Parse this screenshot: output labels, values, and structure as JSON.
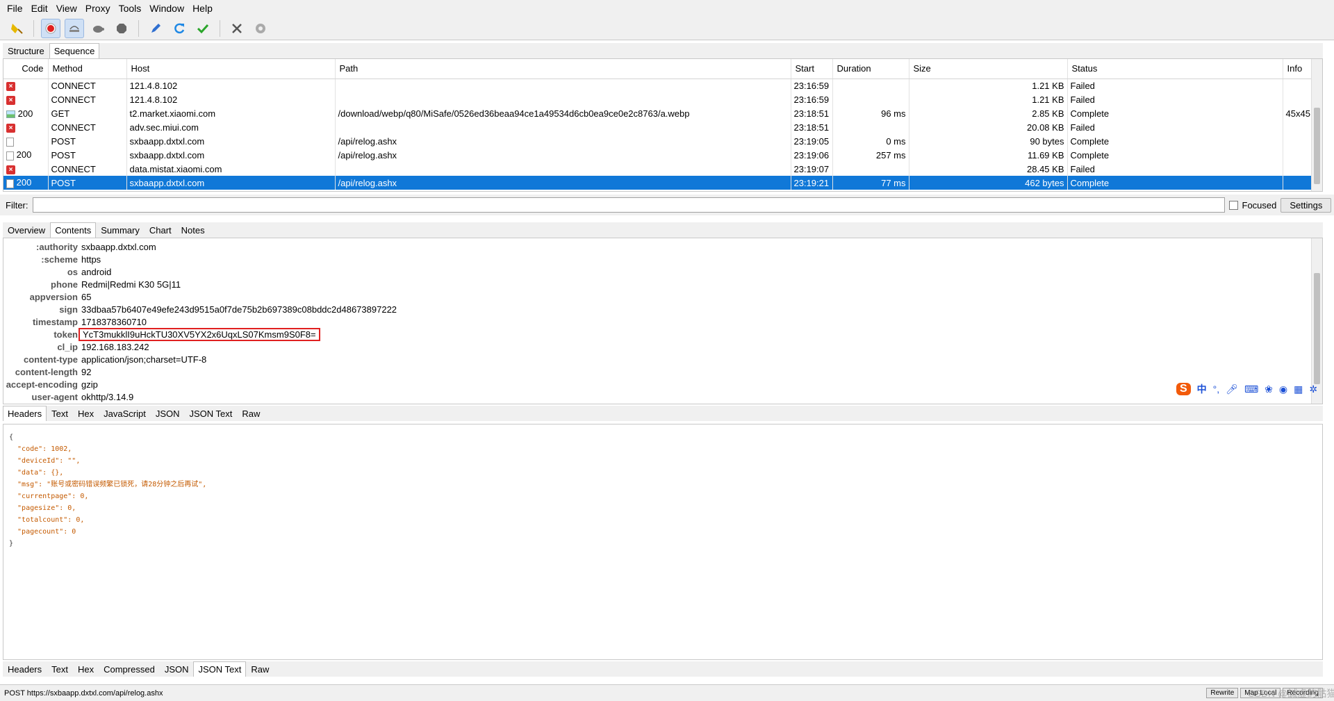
{
  "menubar": {
    "items": [
      "File",
      "Edit",
      "View",
      "Proxy",
      "Tools",
      "Window",
      "Help"
    ]
  },
  "toolbar": {
    "icons": [
      "broom-icon",
      "record-icon",
      "throttle-icon",
      "turtle-icon",
      "stop-icon",
      "pen-icon",
      "refresh-icon",
      "check-icon",
      "tools-icon",
      "gear-icon"
    ]
  },
  "view_tabs": [
    "Structure",
    "Sequence"
  ],
  "table": {
    "columns": [
      "Code",
      "Method",
      "Host",
      "Path",
      "Start",
      "Duration",
      "Size",
      "Status",
      "Info"
    ],
    "rows": [
      {
        "icon": "failed",
        "code": "",
        "method": "CONNECT",
        "host": "121.4.8.102",
        "path": "",
        "start": "23:16:59",
        "duration": "",
        "size": "1.21 KB",
        "status": "Failed",
        "info": ""
      },
      {
        "icon": "failed",
        "code": "",
        "method": "CONNECT",
        "host": "121.4.8.102",
        "path": "",
        "start": "23:16:59",
        "duration": "",
        "size": "1.21 KB",
        "status": "Failed",
        "info": ""
      },
      {
        "icon": "image",
        "code": "200",
        "method": "GET",
        "host": "t2.market.xiaomi.com",
        "path": "/download/webp/q80/MiSafe/0526ed36beaa94ce1a49534d6cb0ea9ce0e2c8763/a.webp",
        "start": "23:18:51",
        "duration": "96 ms",
        "size": "2.85 KB",
        "status": "Complete",
        "info": "45x45"
      },
      {
        "icon": "failed",
        "code": "",
        "method": "CONNECT",
        "host": "adv.sec.miui.com",
        "path": "",
        "start": "23:18:51",
        "duration": "",
        "size": "20.08 KB",
        "status": "Failed",
        "info": ""
      },
      {
        "icon": "doc",
        "code": "",
        "method": "POST",
        "host": "sxbaapp.dxtxl.com",
        "path": "/api/relog.ashx",
        "start": "23:19:05",
        "duration": "0 ms",
        "size": "90 bytes",
        "status": "Complete",
        "info": ""
      },
      {
        "icon": "doc",
        "code": "200",
        "method": "POST",
        "host": "sxbaapp.dxtxl.com",
        "path": "/api/relog.ashx",
        "start": "23:19:06",
        "duration": "257 ms",
        "size": "11.69 KB",
        "status": "Complete",
        "info": ""
      },
      {
        "icon": "failed",
        "code": "",
        "method": "CONNECT",
        "host": "data.mistat.xiaomi.com",
        "path": "",
        "start": "23:19:07",
        "duration": "",
        "size": "28.45 KB",
        "status": "Failed",
        "info": ""
      },
      {
        "icon": "doc",
        "code": "200",
        "method": "POST",
        "host": "sxbaapp.dxtxl.com",
        "path": "/api/relog.ashx",
        "start": "23:19:21",
        "duration": "77 ms",
        "size": "462 bytes",
        "status": "Complete",
        "info": "",
        "selected": true
      }
    ]
  },
  "filter": {
    "label": "Filter:",
    "value": "",
    "focused_label": "Focused",
    "settings_label": "Settings"
  },
  "detail_tabs": [
    "Overview",
    "Contents",
    "Summary",
    "Chart",
    "Notes"
  ],
  "request_headers": [
    {
      "key": ":authority",
      "value": "sxbaapp.dxtxl.com"
    },
    {
      "key": ":scheme",
      "value": "https"
    },
    {
      "key": "os",
      "value": "android"
    },
    {
      "key": "phone",
      "value": "Redmi|Redmi K30 5G|11"
    },
    {
      "key": "appversion",
      "value": "65"
    },
    {
      "key": "sign",
      "value": "33dbaa57b6407e49efe243d9515a0f7de75b2b697389c08bddc2d48673897222"
    },
    {
      "key": "timestamp",
      "value": "1718378360710"
    },
    {
      "key": "token",
      "value": "YcT3mukklI9uHckTU30XV5YX2x6UqxLS07Kmsm9S0F8=",
      "highlight": true
    },
    {
      "key": "cl_ip",
      "value": "192.168.183.242"
    },
    {
      "key": "content-type",
      "value": "application/json;charset=UTF-8"
    },
    {
      "key": "content-length",
      "value": "92"
    },
    {
      "key": "accept-encoding",
      "value": "gzip"
    },
    {
      "key": "user-agent",
      "value": "okhttp/3.14.9"
    }
  ],
  "request_tabs": [
    "Headers",
    "Text",
    "Hex",
    "JavaScript",
    "JSON",
    "JSON Text",
    "Raw"
  ],
  "response_json_lines": [
    "{",
    "  \"code\": 1002,",
    "  \"deviceId\": \"\",",
    "  \"data\": {},",
    "  \"msg\": \"账号或密码错误频繁已锁死，请28分钟之后再试\",",
    "  \"currentpage\": 0,",
    "  \"pagesize\": 0,",
    "  \"totalcount\": 0,",
    "  \"pagecount\": 0",
    "}"
  ],
  "response_tabs": [
    "Headers",
    "Text",
    "Hex",
    "Compressed",
    "JSON",
    "JSON Text",
    "Raw"
  ],
  "statusbar": {
    "text": "POST https://sxbaapp.dxtxl.com/api/relog.ashx",
    "buttons": [
      "Rewrite",
      "Map Local",
      "Recording"
    ],
    "watermark": "CSDN @誠虚的骷猫"
  },
  "ime": {
    "logo": "S",
    "label": "中",
    "icons": [
      "punctuation-icon",
      "microphone-icon",
      "keyboard-icon",
      "skin-icon",
      "game-icon",
      "grid-icon",
      "settings-icon"
    ]
  },
  "colors": {
    "selected_row": "#1078d8",
    "failed": "#d83030",
    "token_highlight": "#e02020",
    "toolbar_bg": "#f0f0f0"
  }
}
